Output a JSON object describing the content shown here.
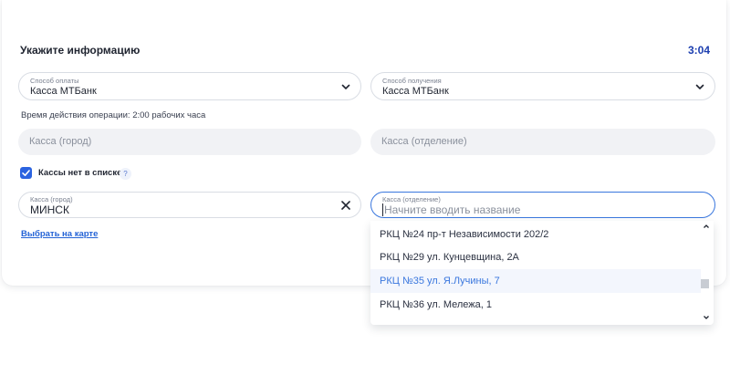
{
  "form": {
    "title": "Укажите информацию",
    "timer": "3:04",
    "payment": {
      "label": "Способ оплаты",
      "value": "Касса МТБанк",
      "icon": "chevron-down-icon"
    },
    "delivery": {
      "label": "Способ получения",
      "value": "Касса МТБанк",
      "icon": "chevron-down-icon"
    },
    "validity_note": "Время действия операции: 2:00 рабочих часа",
    "city_placeholder": "Касса (город)",
    "branch_placeholder": "Касса (отделение)",
    "checkbox_label": "Кассы нет в списке",
    "checkbox_checked": true,
    "help_glyph": "?",
    "city_field": {
      "label": "Касса (город)",
      "value": "МИНСК"
    },
    "branch_field": {
      "label": "Касса (отделение)",
      "placeholder": "Начните вводить название"
    },
    "map_link": "Выбрать на карте"
  },
  "dropdown": {
    "items": [
      "РКЦ №24 пр-т Независимости 202/2",
      "РКЦ №29 ул. Кунцевщина, 2А",
      "РКЦ №35 ул. Я.Лучины, 7",
      "РКЦ №36 ул. Мележа, 1"
    ],
    "highlighted_index": 2
  },
  "colors": {
    "accent": "#2b63e0",
    "timer": "#1d3fb0",
    "focus_border": "#3a77de",
    "highlight_text": "#3a77de"
  }
}
